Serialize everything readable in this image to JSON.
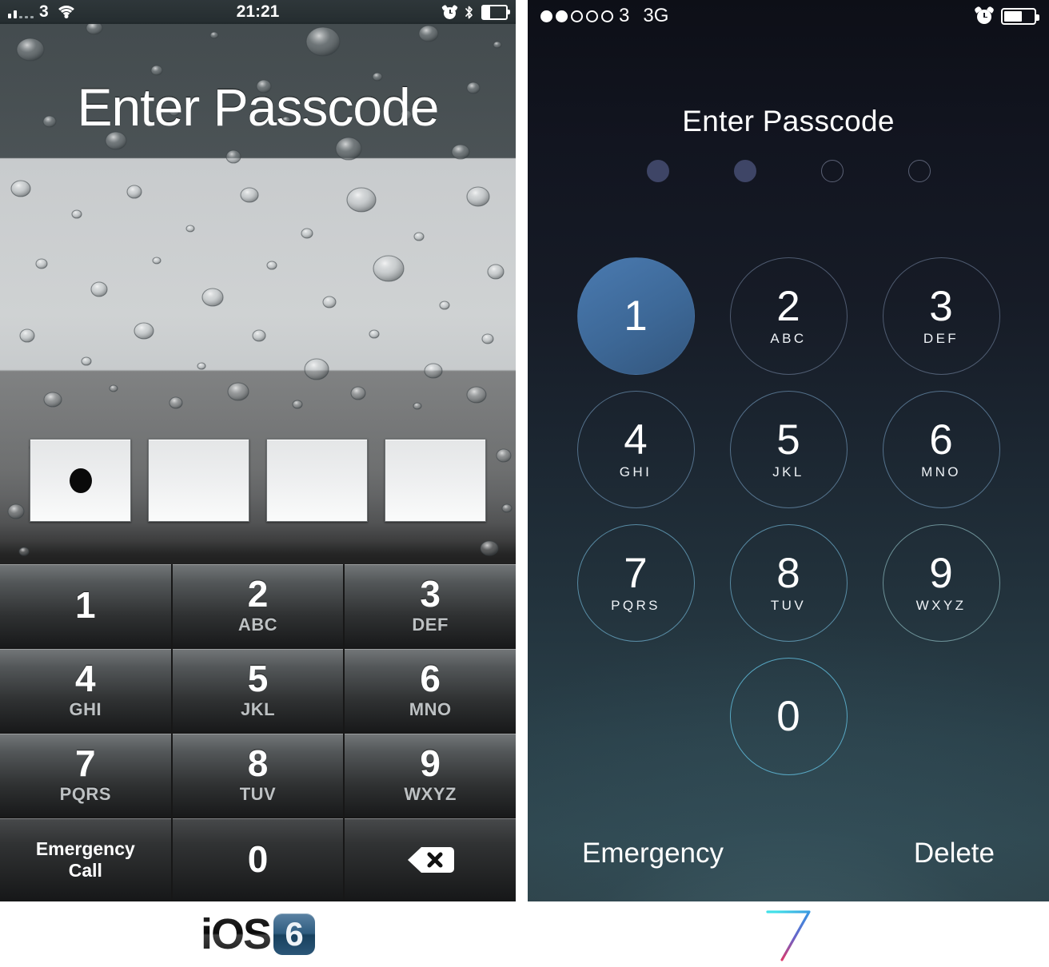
{
  "ios6": {
    "statusbar": {
      "signal_icon": "signal-bars-icon",
      "carrier": "3",
      "wifi_icon": "wifi-icon",
      "time": "21:21",
      "alarm_icon": "alarm-clock-icon",
      "bluetooth_icon": "bluetooth-icon",
      "battery_icon": "battery-icon",
      "battery_level": 30
    },
    "title": "Enter Passcode",
    "passcode": {
      "length": 4,
      "filled": 1
    },
    "keys": [
      {
        "num": "1",
        "letters": ""
      },
      {
        "num": "2",
        "letters": "ABC"
      },
      {
        "num": "3",
        "letters": "DEF"
      },
      {
        "num": "4",
        "letters": "GHI"
      },
      {
        "num": "5",
        "letters": "JKL"
      },
      {
        "num": "6",
        "letters": "MNO"
      },
      {
        "num": "7",
        "letters": "PQRS"
      },
      {
        "num": "8",
        "letters": "TUV"
      },
      {
        "num": "9",
        "letters": "WXYZ"
      }
    ],
    "emergency_call": "Emergency\nCall",
    "emergency_line1": "Emergency",
    "emergency_line2": "Call",
    "zero": "0",
    "delete_icon": "backspace-icon",
    "logo": {
      "text": "iOS",
      "version": "6"
    }
  },
  "ios7": {
    "statusbar": {
      "signal_dots_total": 5,
      "signal_dots_filled": 2,
      "carrier": "3",
      "network": "3G",
      "alarm_icon": "alarm-clock-icon",
      "battery_icon": "battery-icon",
      "battery_level": 62
    },
    "title": "Enter Passcode",
    "passcode": {
      "length": 4,
      "filled": 2
    },
    "keys": [
      {
        "num": "1",
        "letters": "",
        "active": true
      },
      {
        "num": "2",
        "letters": "ABC"
      },
      {
        "num": "3",
        "letters": "DEF"
      },
      {
        "num": "4",
        "letters": "GHI"
      },
      {
        "num": "5",
        "letters": "JKL"
      },
      {
        "num": "6",
        "letters": "MNO"
      },
      {
        "num": "7",
        "letters": "PQRS"
      },
      {
        "num": "8",
        "letters": "TUV"
      },
      {
        "num": "9",
        "letters": "WXYZ"
      },
      {
        "num": "0",
        "letters": ""
      }
    ],
    "emergency": "Emergency",
    "delete": "Delete",
    "logo": {
      "version": "7"
    }
  },
  "colors": {
    "ios7_active_key": "#3d6897",
    "ios7_dot_filled": "#3e4566",
    "ios6_badge_blue": "#2f5d80",
    "ios7_bg_top": "#0d0f17",
    "ios7_bg_bottom": "#2c3e44"
  }
}
